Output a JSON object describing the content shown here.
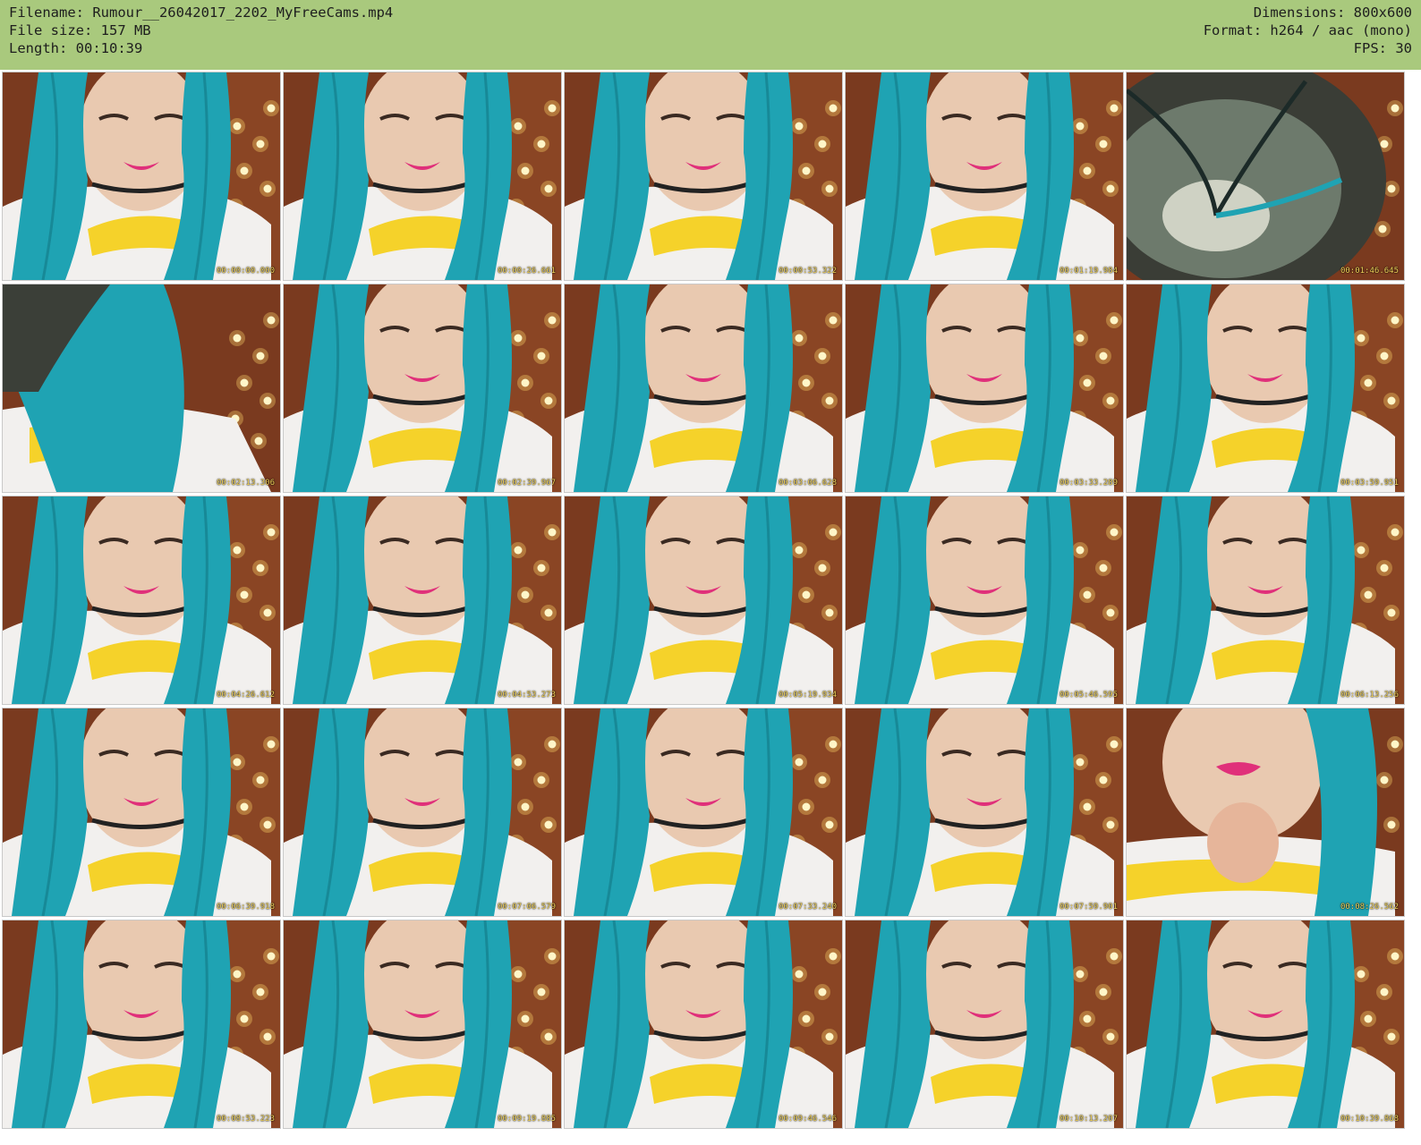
{
  "header": {
    "filename": "Filename: Rumour__26042017_2202_MyFreeCams.mp4",
    "filesize": "File size: 157 MB",
    "length": "Length: 00:10:39",
    "dimensions": "Dimensions: 800x600",
    "format": "Format: h264 / aac (mono)",
    "fps": "FPS: 30",
    "background": "#a9c97d"
  },
  "thumbnails": [
    {
      "timestamp": "00:00:00.000",
      "variant": "face"
    },
    {
      "timestamp": "00:00:26.661",
      "variant": "face"
    },
    {
      "timestamp": "00:00:53.322",
      "variant": "face"
    },
    {
      "timestamp": "00:01:19.984",
      "variant": "face"
    },
    {
      "timestamp": "00:01:46.645",
      "variant": "top-of-head"
    },
    {
      "timestamp": "00:02:13.306",
      "variant": "hair-side"
    },
    {
      "timestamp": "00:02:39.967",
      "variant": "face"
    },
    {
      "timestamp": "00:03:06.628",
      "variant": "face"
    },
    {
      "timestamp": "00:03:33.289",
      "variant": "face"
    },
    {
      "timestamp": "00:03:59.951",
      "variant": "face"
    },
    {
      "timestamp": "00:04:26.612",
      "variant": "face"
    },
    {
      "timestamp": "00:04:53.273",
      "variant": "face"
    },
    {
      "timestamp": "00:05:19.934",
      "variant": "face"
    },
    {
      "timestamp": "00:05:46.595",
      "variant": "face"
    },
    {
      "timestamp": "00:06:13.256",
      "variant": "face"
    },
    {
      "timestamp": "00:06:39.918",
      "variant": "face"
    },
    {
      "timestamp": "00:07:06.579",
      "variant": "face"
    },
    {
      "timestamp": "00:07:33.240",
      "variant": "face"
    },
    {
      "timestamp": "00:07:59.901",
      "variant": "face"
    },
    {
      "timestamp": "00:08:26.562",
      "variant": "close-up"
    },
    {
      "timestamp": "00:08:53.223",
      "variant": "face"
    },
    {
      "timestamp": "00:09:19.885",
      "variant": "face"
    },
    {
      "timestamp": "00:09:46.546",
      "variant": "face"
    },
    {
      "timestamp": "00:10:13.207",
      "variant": "face"
    },
    {
      "timestamp": "00:10:39.868",
      "variant": "face"
    }
  ],
  "colors": {
    "hair": "#1fa3b3",
    "hair_dark": "#0f6f7c",
    "skin": "#e9c9b0",
    "lips": "#e0307a",
    "shirt": "#f2f0ee",
    "shirt_logo": "#f5d22a",
    "background_wall": "#7a3a1f",
    "lights": "#ffd76a",
    "timestamp": "#f3d35a"
  }
}
